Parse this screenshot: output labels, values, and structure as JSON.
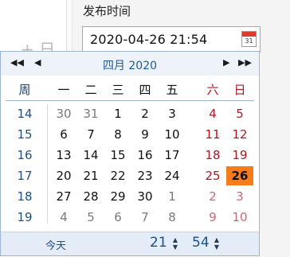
{
  "form": {
    "field_label": "发布时间",
    "date_value": "2020-04-26 21:54",
    "calendar_icon_label": "31",
    "background_glyph": "+ 日"
  },
  "picker": {
    "month_title": "四月 2020",
    "nav": {
      "prev_year": "◀◀",
      "prev_month": "◀",
      "next_month": "▶",
      "next_year": "▶▶"
    },
    "week_header": "周",
    "day_headers": [
      "一",
      "二",
      "三",
      "四",
      "五",
      "六",
      "日"
    ],
    "week_numbers": [
      "14",
      "15",
      "16",
      "17",
      "18",
      "19"
    ],
    "days": [
      [
        "30",
        "31",
        "1",
        "2",
        "3",
        "4",
        "5"
      ],
      [
        "6",
        "7",
        "8",
        "9",
        "10",
        "11",
        "12"
      ],
      [
        "13",
        "14",
        "15",
        "16",
        "17",
        "18",
        "19"
      ],
      [
        "20",
        "21",
        "22",
        "23",
        "24",
        "25",
        "26"
      ],
      [
        "27",
        "28",
        "29",
        "30",
        "1",
        "2",
        "3"
      ],
      [
        "4",
        "5",
        "6",
        "7",
        "8",
        "9",
        "10"
      ]
    ],
    "selected_day": "26",
    "today_label": "今天",
    "hour": "21",
    "minute": "54",
    "spin_up": "▲",
    "spin_down": "▼"
  },
  "colors": {
    "selected": "#f57c1c",
    "weekend": "#b4141e",
    "accent": "#1c5a9c"
  },
  "icons": {
    "calendar": "calendar-icon"
  }
}
